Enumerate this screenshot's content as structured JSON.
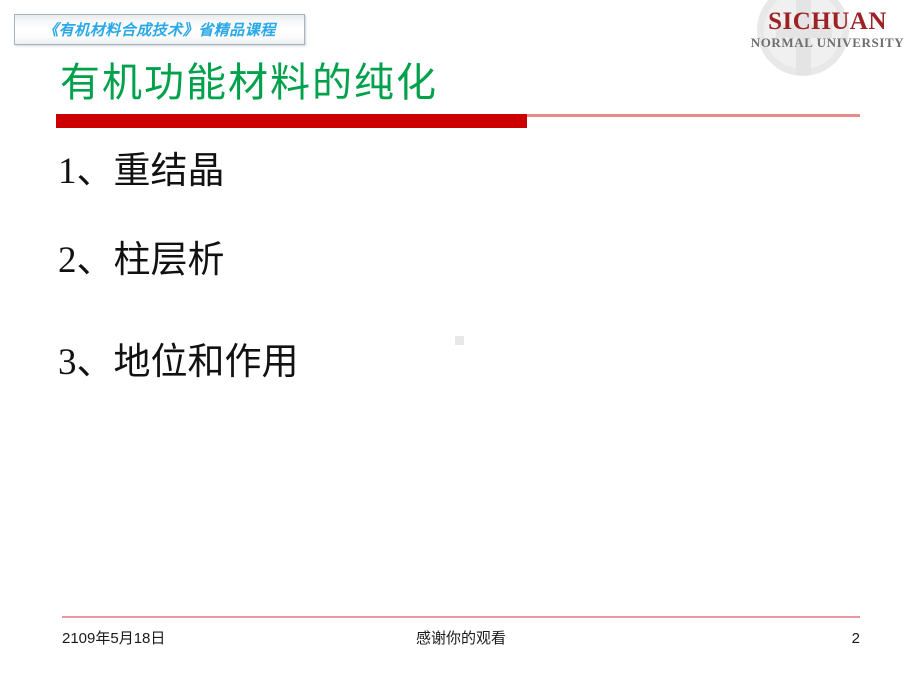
{
  "badge": {
    "text": "《有机材料合成技术》省精品课程"
  },
  "logo": {
    "main": "SICHUAN",
    "sub": "NORMAL UNIVERSITY",
    "watermark": "university-seal-watermark"
  },
  "title": {
    "text": "有机功能材料的纯化"
  },
  "body": {
    "items": [
      {
        "text": "1、重结晶"
      },
      {
        "text": "2、柱层析"
      },
      {
        "text": "3、地位和作用"
      }
    ]
  },
  "footer": {
    "date": "2109年5月18日",
    "note": "感谢你的观看",
    "page": "2"
  },
  "colors": {
    "badge_text": "#2aa8e8",
    "badge_border": "#a9b3bd",
    "logo_main": "#9e2225",
    "logo_sub": "#6e6e6e",
    "title_green": "#00a14b",
    "rule_thick_red": "#cc0000",
    "rule_thin_pink": "#e8898c",
    "footer_rule_pink": "#e8999b",
    "body_text": "#111111",
    "background": "#ffffff"
  }
}
